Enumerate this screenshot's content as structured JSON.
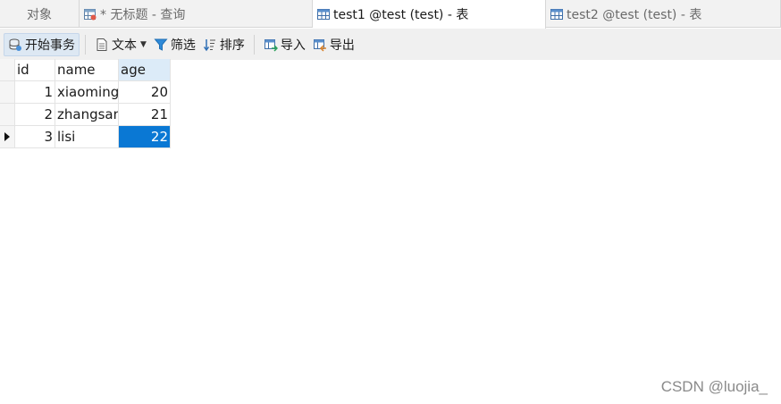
{
  "tabs": [
    {
      "label": "对象",
      "icon": "none",
      "active": false
    },
    {
      "label": "* 无标题 - 查询",
      "icon": "query-table-icon",
      "active": false
    },
    {
      "label": "test1 @test (test) - 表",
      "icon": "table-icon",
      "active": true
    },
    {
      "label": "test2 @test (test) - 表",
      "icon": "table-icon",
      "active": false
    }
  ],
  "toolbar": {
    "begin_transaction": "开始事务",
    "text": "文本",
    "filter": "筛选",
    "sort": "排序",
    "import": "导入",
    "export": "导出"
  },
  "grid": {
    "columns": [
      "id",
      "name",
      "age"
    ],
    "rows": [
      {
        "id": "1",
        "name": "xiaoming",
        "age": "20"
      },
      {
        "id": "2",
        "name": "zhangsan",
        "age": "21"
      },
      {
        "id": "3",
        "name": "lisi",
        "age": "22"
      }
    ],
    "selected_row": 3,
    "selected_column": "age"
  },
  "colors": {
    "accent": "#0a78d4",
    "header_highlight": "#dcebf8"
  },
  "watermark": "CSDN @luojia_"
}
